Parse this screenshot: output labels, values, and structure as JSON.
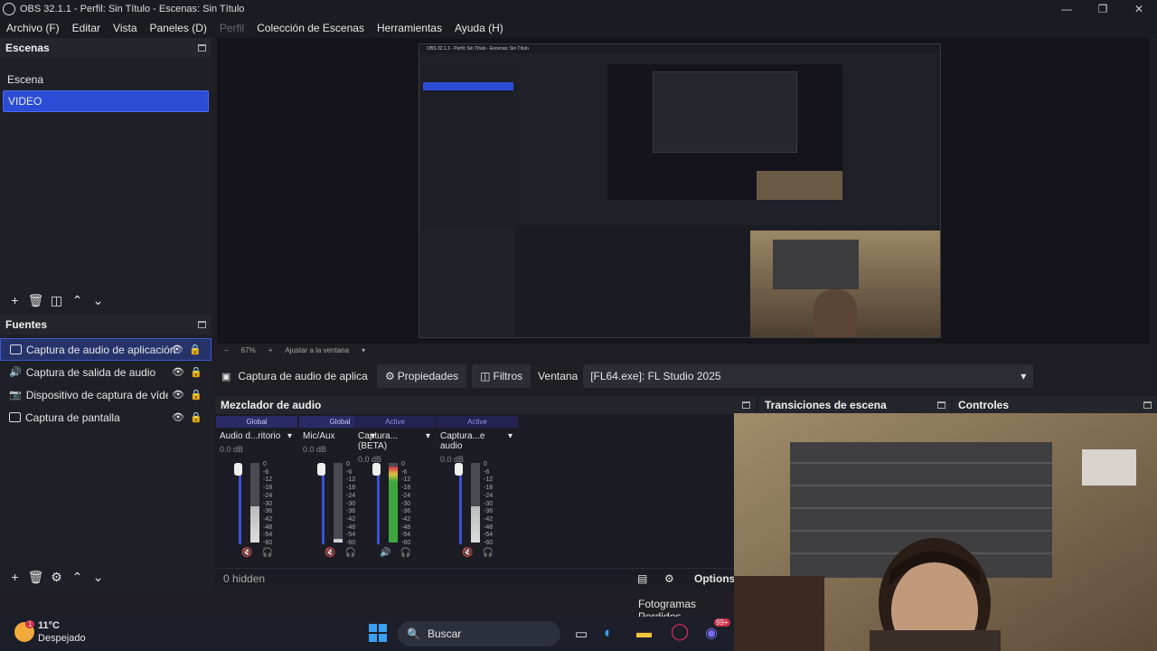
{
  "window": {
    "title": "OBS 32.1.1 - Perfil: Sin Título - Escenas: Sin Título"
  },
  "menu": [
    {
      "label": "Archivo (F)",
      "enabled": true
    },
    {
      "label": "Editar",
      "enabled": true
    },
    {
      "label": "Vista",
      "enabled": true
    },
    {
      "label": "Paneles (D)",
      "enabled": true
    },
    {
      "label": "Perfil",
      "enabled": false
    },
    {
      "label": "Colección de Escenas",
      "enabled": true
    },
    {
      "label": "Herramientas",
      "enabled": true
    },
    {
      "label": "Ayuda (H)",
      "enabled": true
    }
  ],
  "scenes": {
    "title": "Escenas",
    "items": [
      {
        "label": "Escena",
        "selected": false
      },
      {
        "label": "VIDEO",
        "selected": true
      }
    ]
  },
  "sources": {
    "title": "Fuentes",
    "items": [
      {
        "label": "Captura de audio de aplicación",
        "icon": "app-audio-icon",
        "selected": true
      },
      {
        "label": "Captura de salida de audio",
        "icon": "speaker-icon",
        "selected": false
      },
      {
        "label": "Dispositivo de captura de vídeo",
        "icon": "camera-icon",
        "selected": false
      },
      {
        "label": "Captura de pantalla",
        "icon": "monitor-icon",
        "selected": false
      }
    ]
  },
  "zoombar": {
    "zoom": "67%",
    "fit": "Ajustar a la ventana"
  },
  "context": {
    "source_name": "Captura de audio de aplica",
    "properties": "Propiedades",
    "filters": "Filtros",
    "window_label": "Ventana",
    "window_value": "[FL64.exe]: FL Studio 2025"
  },
  "mixer": {
    "title": "Mezclador de audio",
    "channels": [
      {
        "tag": "Global",
        "name": "Audio d...ritorio",
        "db": "0.0 dB",
        "level": 0.45,
        "muted": true
      },
      {
        "tag": "Global",
        "name": "Mic/Aux",
        "db": "0.0 dB",
        "level": 0.05,
        "muted": true
      },
      {
        "tag": "Active",
        "name": "Captura... (BETA)",
        "db": "0.0 dB",
        "level": 0.95,
        "muted": false
      },
      {
        "tag": "Active",
        "name": "Captura...e audio",
        "db": "0.0 dB",
        "level": 0.45,
        "muted": true
      }
    ],
    "scale": [
      "0",
      "-6",
      "-12",
      "-18",
      "-24",
      "-30",
      "-36",
      "-42",
      "-48",
      "-54",
      "-60"
    ],
    "hidden": "0 hidden",
    "options": "Options"
  },
  "transitions": {
    "title": "Transiciones de escena"
  },
  "controls": {
    "title": "Controles"
  },
  "stats": {
    "dropped": "Fotogramas Perdidos"
  },
  "weather": {
    "temp": "11°C",
    "desc": "Despejado",
    "badge": "1"
  },
  "taskbar": {
    "search": "Buscar",
    "badge": "99+"
  },
  "nested": {
    "title": "OBS 32.1.1 - Perfil: Sin Título - Escenas: Sin Título"
  },
  "colors": {
    "accent": "#2b4dd6",
    "meter_green": "#3fa63f",
    "meter_red": "#d0304a"
  }
}
